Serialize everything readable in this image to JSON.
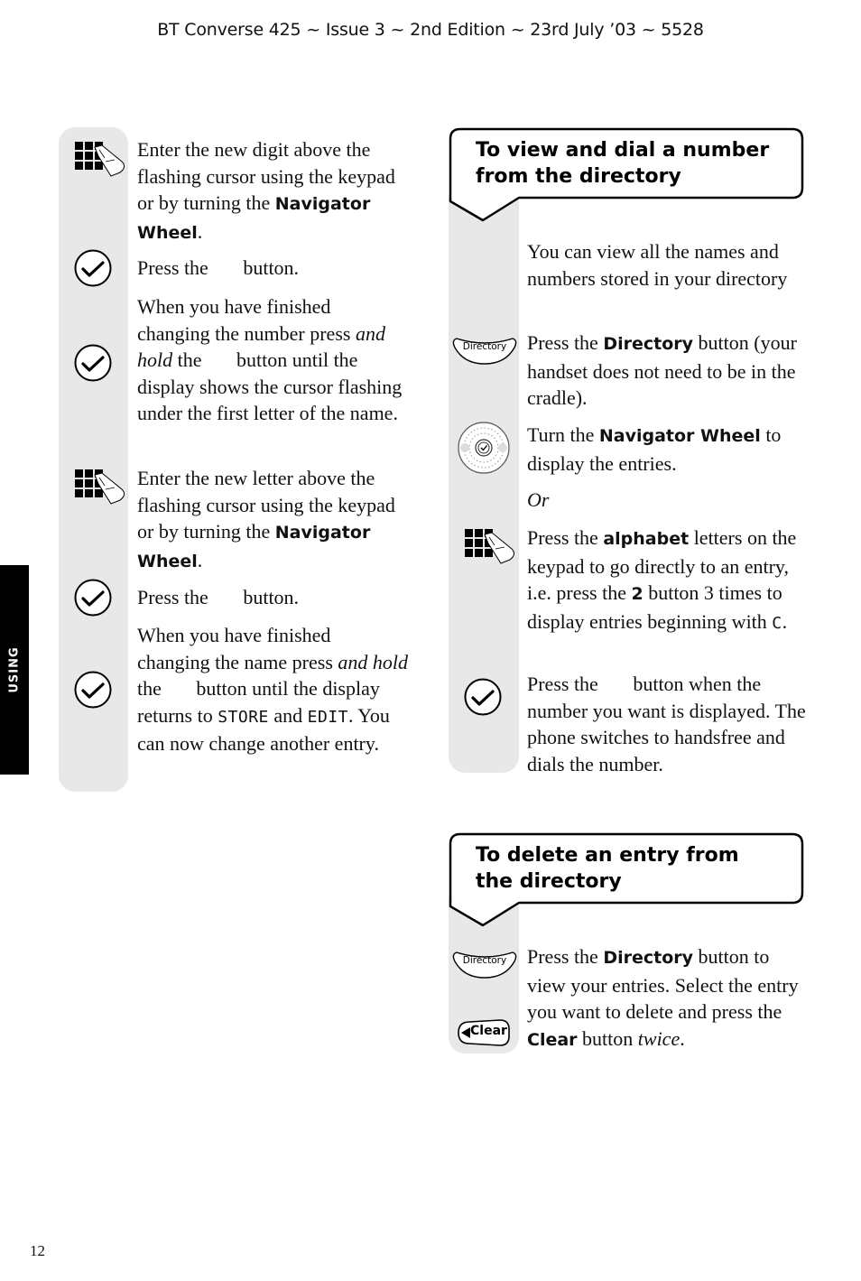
{
  "header": {
    "text": "BT Converse 425 ~ Issue 3 ~ 2nd Edition ~ 23rd July ’03 ~ 5528"
  },
  "side_tab": {
    "label": "USING"
  },
  "page_number": "12",
  "left_column": {
    "steps": [
      {
        "icon": "keypad-icon",
        "parts": [
          {
            "t": "Enter the new digit above the flashing cursor using the keypad or by turning the "
          },
          {
            "b": "Navigator Wheel"
          },
          {
            "t": "."
          }
        ]
      },
      {
        "icon": "ok-check-icon",
        "parts": [
          {
            "t": "Press the   button."
          }
        ]
      },
      {
        "icon": "ok-check-icon",
        "parts": [
          {
            "t": "When you have finished changing the number press "
          },
          {
            "i": "and hold"
          },
          {
            "t": " the   button until the display shows the cursor flashing under the first letter of the name."
          }
        ]
      },
      {
        "icon": "keypad-icon",
        "parts": [
          {
            "t": "Enter the new letter above the flashing cursor using the keypad or by turning the "
          },
          {
            "b": "Navigator Wheel"
          },
          {
            "t": "."
          }
        ]
      },
      {
        "icon": "ok-check-icon",
        "parts": [
          {
            "t": "Press the   button."
          }
        ]
      },
      {
        "icon": "ok-check-icon",
        "parts": [
          {
            "t": "When you have finished changing the name press "
          },
          {
            "i": "and hold"
          },
          {
            "t": " the   button until the display returns to "
          },
          {
            "lcd": "STORE"
          },
          {
            "t": " and "
          },
          {
            "lcd": "EDIT"
          },
          {
            "t": ". You can now change another entry."
          }
        ]
      }
    ]
  },
  "section_view": {
    "title": "To view and dial a number from the directory",
    "steps": [
      {
        "icon": null,
        "parts": [
          {
            "t": "You can view all the names and numbers stored in your directory"
          }
        ]
      },
      {
        "icon": "directory-button-icon",
        "icon_label": "Directory",
        "parts": [
          {
            "t": "Press the "
          },
          {
            "b": "Directory"
          },
          {
            "t": " button (your handset does not need to be in the cradle)."
          }
        ]
      },
      {
        "icon": "navigator-wheel-icon",
        "parts": [
          {
            "t": "Turn the "
          },
          {
            "b": "Navigator Wheel"
          },
          {
            "t": " to display the entries."
          }
        ]
      },
      {
        "icon": null,
        "parts": [
          {
            "i": "Or"
          }
        ]
      },
      {
        "icon": "keypad-icon",
        "parts": [
          {
            "t": "Press the "
          },
          {
            "b": "alphabet"
          },
          {
            "t": " letters on the keypad to go directly to an entry, i.e. press the "
          },
          {
            "b": "2"
          },
          {
            "t": " button 3 times to display entries beginning with "
          },
          {
            "lcd": "C"
          },
          {
            "t": "."
          }
        ]
      },
      {
        "icon": "ok-check-icon",
        "parts": [
          {
            "t": "Press the   button when the number you want is displayed. The phone  switches to handsfree and dials the number."
          }
        ]
      }
    ]
  },
  "section_delete": {
    "title": "To delete an entry from the directory",
    "icons": [
      {
        "icon": "directory-button-icon",
        "label": "Directory"
      },
      {
        "icon": "clear-button-icon",
        "label": "Clear"
      }
    ],
    "parts": [
      {
        "t": "Press the "
      },
      {
        "b": "Directory"
      },
      {
        "t": " button to view your entries. Select the entry you want to delete and press the "
      },
      {
        "b": "Clear"
      },
      {
        "t": " button "
      },
      {
        "i": "twice"
      },
      {
        "t": "."
      }
    ]
  }
}
